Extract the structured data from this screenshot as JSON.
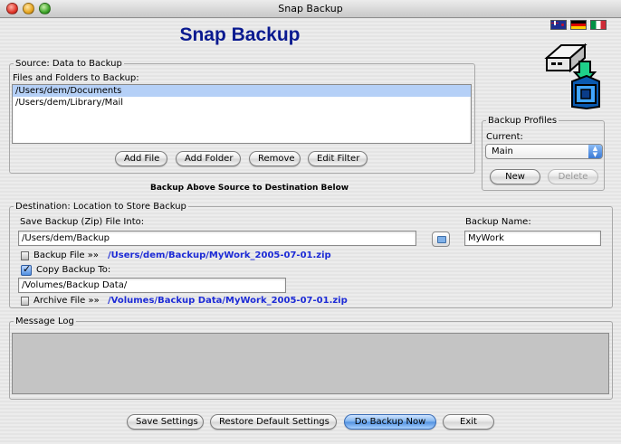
{
  "window": {
    "title": "Snap Backup"
  },
  "app_title": "Snap Backup",
  "flags": [
    "new-zealand-flag-icon",
    "germany-flag-icon",
    "italy-flag-icon"
  ],
  "source": {
    "legend": "Source: Data to Backup",
    "files_label": "Files and Folders to Backup:",
    "items": [
      "/Users/dem/Documents",
      "/Users/dem/Library/Mail"
    ],
    "buttons": {
      "add_file": "Add File",
      "add_folder": "Add Folder",
      "remove": "Remove",
      "edit_filter": "Edit Filter"
    }
  },
  "caption": "Backup Above Source to Destination Below",
  "profiles": {
    "legend": "Backup Profiles",
    "current_label": "Current:",
    "current_value": "Main",
    "new": "New",
    "delete": "Delete"
  },
  "destination": {
    "legend": "Destination: Location to Store Backup",
    "save_label": "Save Backup (Zip) File Into:",
    "save_path": "/Users/dem/Backup",
    "name_label": "Backup Name:",
    "name_value": "MyWork",
    "backup_file_label": "Backup File »»",
    "backup_file_path": "/Users/dem/Backup/MyWork_2005-07-01.zip",
    "copy_label": "Copy Backup To:",
    "copy_checked": true,
    "copy_path": "/Volumes/Backup Data/",
    "archive_file_label": "Archive File »»",
    "archive_file_path": "/Volumes/Backup Data/MyWork_2005-07-01.zip"
  },
  "message_log": {
    "legend": "Message Log"
  },
  "footer": {
    "save_settings": "Save Settings",
    "restore_defaults": "Restore Default Settings",
    "do_backup": "Do Backup Now",
    "exit": "Exit"
  }
}
